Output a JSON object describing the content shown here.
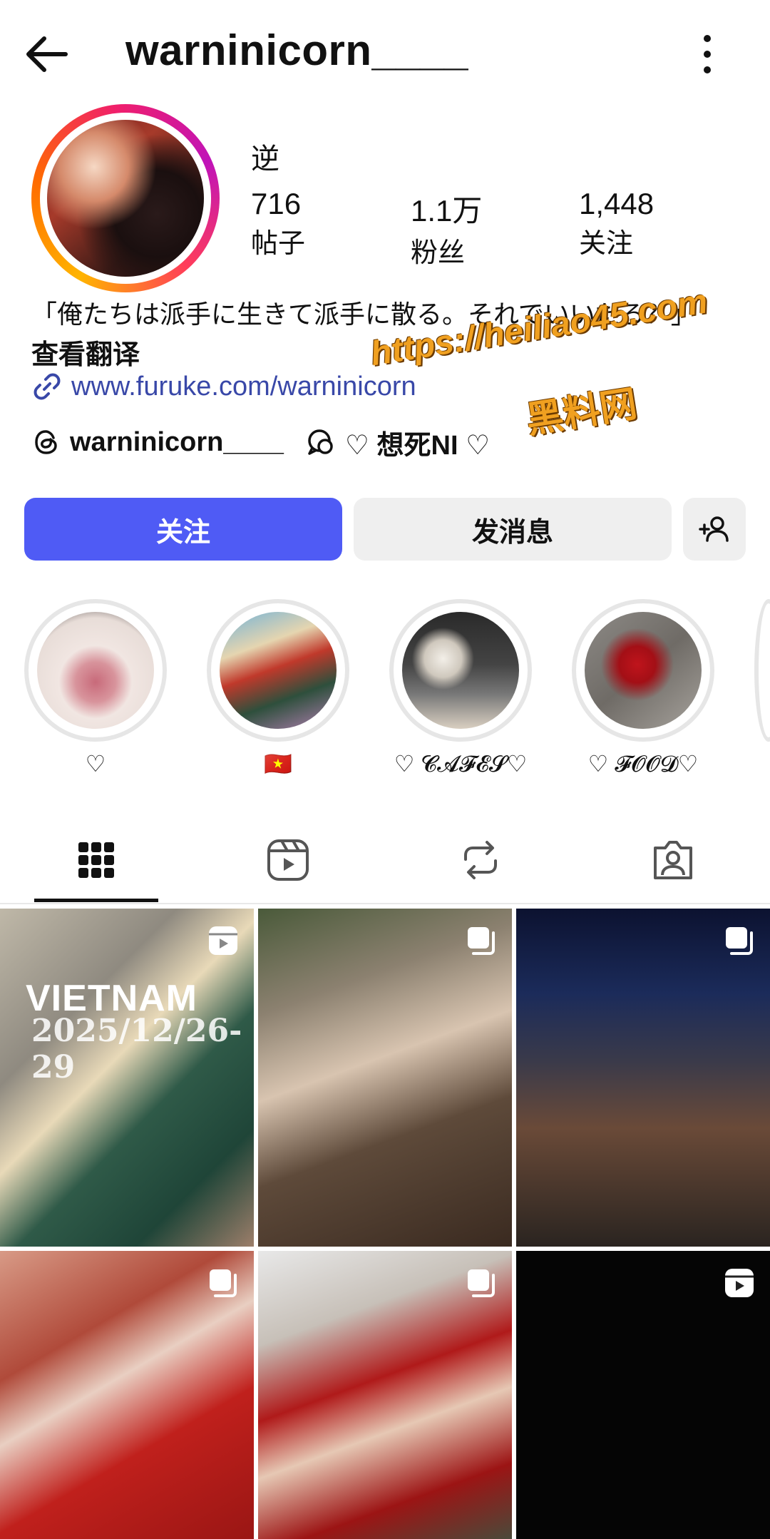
{
  "header": {
    "username": "warninicorn____"
  },
  "profile": {
    "nickname": "逆",
    "stats": [
      {
        "value": "716",
        "label": "帖子"
      },
      {
        "value": "1.1万",
        "label": "粉丝"
      },
      {
        "value": "1,448",
        "label": "关注"
      }
    ],
    "bio": "「俺たちは派手に生きて派手に散る。それでいいだろ？」",
    "translate_label": "查看翻译",
    "link": "www.furuke.com/warninicorn",
    "threads_handle": "warninicorn____",
    "threads_tag": "♡ 想死NI ♡"
  },
  "watermark": {
    "line1": "https://heiliao45.com",
    "line2": "黑料网"
  },
  "actions": {
    "follow_label": "关注",
    "message_label": "发消息"
  },
  "highlights": [
    {
      "label": "♡"
    },
    {
      "label": "🇻🇳"
    },
    {
      "label": "♡ 𝓒𝓐𝓕𝓔𝓢♡"
    },
    {
      "label": "♡ 𝓕𝓞𝓞𝓓♡"
    }
  ],
  "grid": {
    "first_post_title": "VIETNAM",
    "first_post_date": "2025/12/26-29"
  },
  "colors": {
    "follow_button": "#4f5bf5",
    "link": "#3948a8",
    "watermark": "#f0a020"
  },
  "icons": [
    "back-arrow-icon",
    "more-vertical-icon",
    "link-icon",
    "threads-icon",
    "threads-chat-icon",
    "add-user-icon",
    "grid-icon",
    "reels-icon",
    "reposts-icon",
    "tagged-icon",
    "reel-badge-icon",
    "carousel-badge-icon"
  ]
}
